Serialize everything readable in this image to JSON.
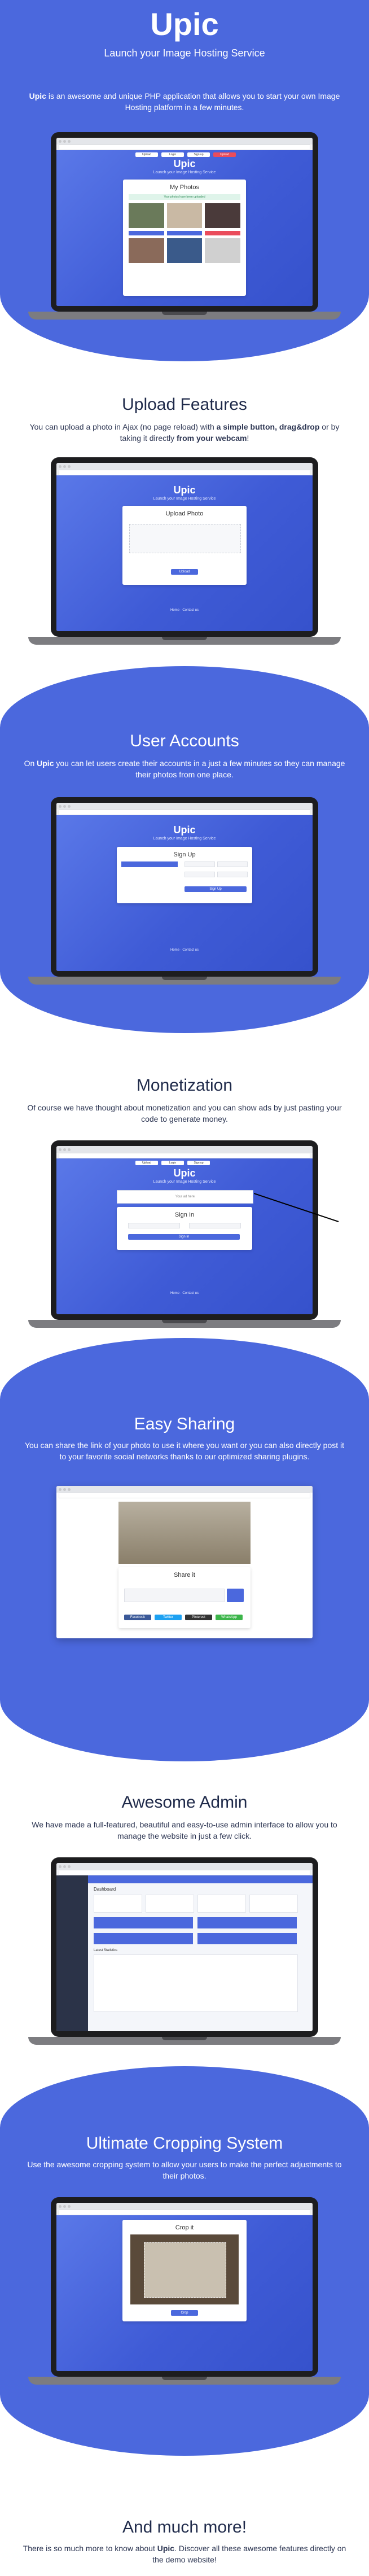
{
  "hero": {
    "logo": "Upic",
    "tagline": "Launch your Image Hosting Service",
    "desc_brand": "Upic",
    "desc_rest": " is an awesome and unique PHP application that allows you to start your own Image Hosting platform in a few minutes."
  },
  "app": {
    "logo": "Upic",
    "subtitle": "Launch your Image Hosting Service",
    "nav": [
      "Upload",
      "Login",
      "Sign up",
      "Upload"
    ],
    "footer": "Home  ·  Contact us"
  },
  "screen1": {
    "card_title": "My Photos",
    "notice": "Your photos have been uploaded"
  },
  "upload": {
    "title": "Upload Features",
    "desc_a": "You can upload a photo in Ajax (no page reload) with ",
    "desc_b": "a simple button, drag&drop",
    "desc_c": " or by taking it directly ",
    "desc_d": "from your webcam",
    "desc_e": "!",
    "card_title": "Upload Photo",
    "button": "Upload"
  },
  "accounts": {
    "title": "User Accounts",
    "desc_a": "On ",
    "desc_brand": "Upic",
    "desc_b": " you can let users create their accounts in a just a few minutes so they can manage their photos from one place.",
    "card_title": "Sign Up",
    "button": "Sign Up"
  },
  "monetization": {
    "title": "Monetization",
    "desc": "Of course we have thought about monetization and you can show ads by just pasting your code to generate money.",
    "card_title": "Sign In",
    "button": "Sign In",
    "ad_text": "Your ad here"
  },
  "sharing": {
    "title": "Easy Sharing",
    "desc": "You can share the link of your photo to use it where you want or you can also directly post it to your favorite social networks thanks to our optimized sharing plugins.",
    "card_title": "Share it",
    "buttons": [
      "Facebook",
      "Twitter",
      "Pinterest",
      "WhatsApp"
    ]
  },
  "admin": {
    "title": "Awesome Admin",
    "desc": "We have made a full-featured, beautiful and easy-to-use admin interface to allow you to manage the website in just a few click.",
    "header": "Dashboard",
    "panel": "Latest Statistics"
  },
  "cropping": {
    "title": "Ultimate Cropping System",
    "desc": "Use the awesome cropping system to allow your users to make the perfect adjustments to their photos.",
    "card_title": "Crop it",
    "button": "Crop"
  },
  "more": {
    "title": "And much more!",
    "desc_a": "There is so much more to know about ",
    "desc_brand": "Upic",
    "desc_b": ". Discover all these awesome features directly on the demo website!"
  },
  "colors": {
    "brand": "#4b68dd",
    "dark": "#1f2a4a",
    "laptop": "#1d1d1f"
  }
}
